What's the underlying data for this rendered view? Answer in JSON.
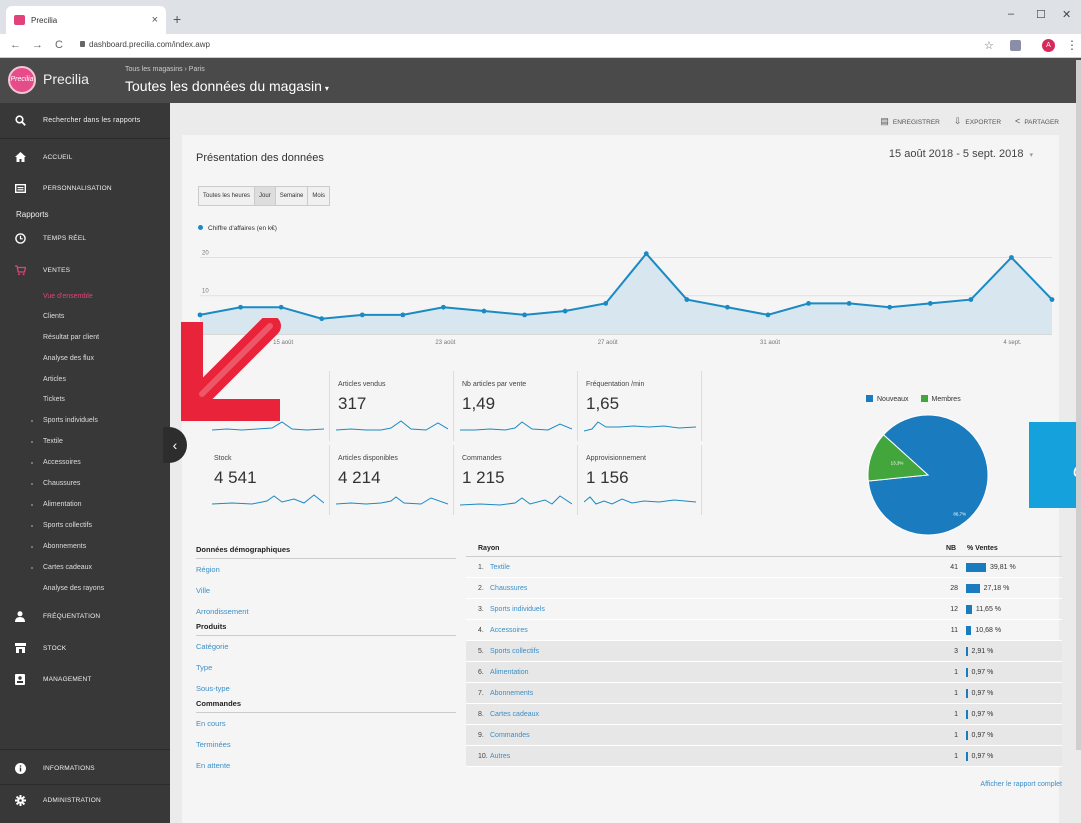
{
  "browser": {
    "tab_title": "Precilia",
    "tab_close": "×",
    "new_tab": "+",
    "url": "dashboard.precilia.com/index.awp",
    "profile_initial": "A",
    "back": "←",
    "forward": "→",
    "reload": "C",
    "bookmark": "☆",
    "menu": "⋮",
    "minimize": "–",
    "maximize": "☐",
    "close": "✕"
  },
  "app": {
    "brand": "Precilia",
    "logo_text": "Precilia",
    "breadcrumb": "Tous les magasins › Paris",
    "store_title": "Toutes les données du magasin",
    "store_caret": "▾"
  },
  "sidebar": {
    "search_label": "Rechercher dans les rapports",
    "accueil": "ACCUEIL",
    "personnalisation": "PERSONNALISATION",
    "rapports": "Rapports",
    "temps_reel": "TEMPS RÉEL",
    "ventes": "VENTES",
    "ventes_sub": [
      "Vue d'ensemble",
      "Clients",
      "Résultat par client",
      "Analyse des flux",
      "Articles",
      "Tickets"
    ],
    "rayons_sub": [
      "Sports individuels",
      "Textile",
      "Accessoires",
      "Chaussures",
      "Alimentation",
      "Sports collectifs",
      "Abonnements",
      "Cartes cadeaux"
    ],
    "analyse_rayons": "Analyse des rayons",
    "frequentation": "FRÉQUENTATION",
    "stock": "STOCK",
    "management": "MANAGEMENT",
    "informations": "INFORMATIONS",
    "administration": "ADMINISTRATION",
    "collapse": "‹"
  },
  "actions": {
    "enregistrer": "ENREGISTRER",
    "exporter": "EXPORTER",
    "partager": "PARTAGER"
  },
  "overview": {
    "title": "Présentation des données",
    "date_range": "15 août 2018 - 5 sept. 2018",
    "date_caret": "▾",
    "segments": [
      "Toutes les heures",
      "Jour",
      "Semaine",
      "Mois"
    ],
    "active_segment": "Jour"
  },
  "chart_data": {
    "type": "area",
    "series": [
      {
        "name": "Chiffre d'affaires (en k€)",
        "values": [
          5,
          7,
          7,
          4,
          5,
          5,
          7,
          6,
          5,
          6,
          8,
          21,
          9,
          7,
          5,
          8,
          8,
          7,
          8,
          9,
          20,
          9
        ]
      }
    ],
    "x_ticks": [
      "15 août",
      "23 août",
      "27 août",
      "31 août",
      "4 sept."
    ],
    "y_ticks": [
      "20",
      "10"
    ],
    "ylim": [
      0,
      23
    ],
    "color": "#1a8ac3",
    "fill": "#d8e6ef",
    "grid": true
  },
  "kpis": [
    {
      "label": "Articles vendus",
      "value": "317"
    },
    {
      "label": "Nb articles par vente",
      "value": "1,49"
    },
    {
      "label": "Fréquentation /min",
      "value": "1,65"
    },
    {
      "label": "Stock",
      "value": "4 541"
    },
    {
      "label": "Articles disponibles",
      "value": "4 214"
    },
    {
      "label": "Commandes",
      "value": "1 215"
    },
    {
      "label": "Approvisionnement",
      "value": "1 156"
    }
  ],
  "pie": {
    "legend": [
      "Nouveaux",
      "Membres"
    ],
    "values": [
      86.7,
      13.3
    ],
    "labels": [
      "86,7%",
      "13,3%"
    ],
    "colors": [
      "#1a7cbf",
      "#43a63d"
    ]
  },
  "demographics": {
    "sections": [
      {
        "title": "Données démographiques",
        "links": [
          "Région",
          "Ville",
          "Arrondissement"
        ]
      },
      {
        "title": "Produits",
        "links": [
          "Catégorie",
          "Type",
          "Sous-type"
        ]
      },
      {
        "title": "Commandes",
        "links": [
          "En cours",
          "Terminées",
          "En attente"
        ]
      }
    ]
  },
  "rayons": {
    "header_name": "Rayon",
    "header_nb": "NB",
    "header_pct": "% Ventes",
    "rows": [
      {
        "num": "1.",
        "name": "Textile",
        "nb": "41",
        "pct_label": "39,81 %",
        "pct": 39.81
      },
      {
        "num": "2.",
        "name": "Chaussures",
        "nb": "28",
        "pct_label": "27,18 %",
        "pct": 27.18
      },
      {
        "num": "3.",
        "name": "Sports individuels",
        "nb": "12",
        "pct_label": "11,65 %",
        "pct": 11.65
      },
      {
        "num": "4.",
        "name": "Accessoires",
        "nb": "11",
        "pct_label": "10,68 %",
        "pct": 10.68
      },
      {
        "num": "5.",
        "name": "Sports collectifs",
        "nb": "3",
        "pct_label": "2,91 %",
        "pct": 2.91
      },
      {
        "num": "6.",
        "name": "Alimentation",
        "nb": "1",
        "pct_label": "0,97 %",
        "pct": 0.97
      },
      {
        "num": "7.",
        "name": "Abonnements",
        "nb": "1",
        "pct_label": "0,97 %",
        "pct": 0.97
      },
      {
        "num": "8.",
        "name": "Cartes cadeaux",
        "nb": "1",
        "pct_label": "0,97 %",
        "pct": 0.97
      },
      {
        "num": "9.",
        "name": "Commandes",
        "nb": "1",
        "pct_label": "0,97 %",
        "pct": 0.97
      },
      {
        "num": "10.",
        "name": "Autres",
        "nb": "1",
        "pct_label": "0,97 %",
        "pct": 0.97
      }
    ],
    "report_link": "Afficher le rapport complet"
  },
  "overlay": {
    "blue_box_glyph": "o"
  }
}
